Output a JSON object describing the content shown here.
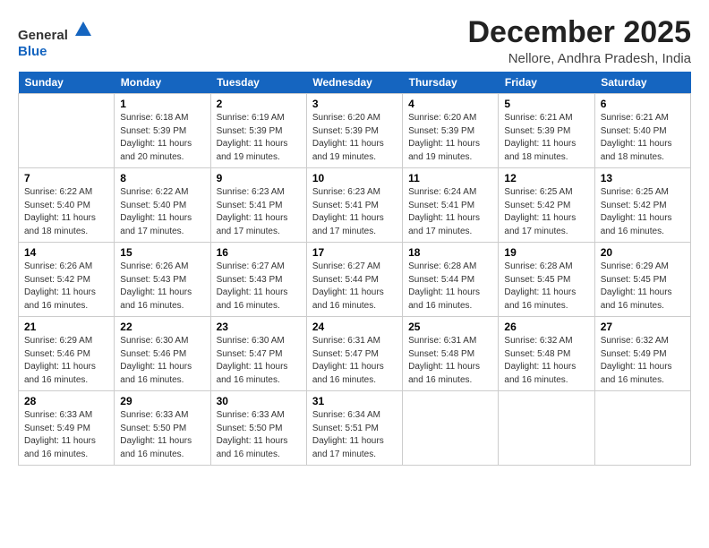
{
  "header": {
    "logo_general": "General",
    "logo_blue": "Blue",
    "title": "December 2025",
    "subtitle": "Nellore, Andhra Pradesh, India"
  },
  "calendar": {
    "headers": [
      "Sunday",
      "Monday",
      "Tuesday",
      "Wednesday",
      "Thursday",
      "Friday",
      "Saturday"
    ],
    "rows": [
      [
        {
          "day": "",
          "info": ""
        },
        {
          "day": "1",
          "info": "Sunrise: 6:18 AM\nSunset: 5:39 PM\nDaylight: 11 hours\nand 20 minutes."
        },
        {
          "day": "2",
          "info": "Sunrise: 6:19 AM\nSunset: 5:39 PM\nDaylight: 11 hours\nand 19 minutes."
        },
        {
          "day": "3",
          "info": "Sunrise: 6:20 AM\nSunset: 5:39 PM\nDaylight: 11 hours\nand 19 minutes."
        },
        {
          "day": "4",
          "info": "Sunrise: 6:20 AM\nSunset: 5:39 PM\nDaylight: 11 hours\nand 19 minutes."
        },
        {
          "day": "5",
          "info": "Sunrise: 6:21 AM\nSunset: 5:39 PM\nDaylight: 11 hours\nand 18 minutes."
        },
        {
          "day": "6",
          "info": "Sunrise: 6:21 AM\nSunset: 5:40 PM\nDaylight: 11 hours\nand 18 minutes."
        }
      ],
      [
        {
          "day": "7",
          "info": "Sunrise: 6:22 AM\nSunset: 5:40 PM\nDaylight: 11 hours\nand 18 minutes."
        },
        {
          "day": "8",
          "info": "Sunrise: 6:22 AM\nSunset: 5:40 PM\nDaylight: 11 hours\nand 17 minutes."
        },
        {
          "day": "9",
          "info": "Sunrise: 6:23 AM\nSunset: 5:41 PM\nDaylight: 11 hours\nand 17 minutes."
        },
        {
          "day": "10",
          "info": "Sunrise: 6:23 AM\nSunset: 5:41 PM\nDaylight: 11 hours\nand 17 minutes."
        },
        {
          "day": "11",
          "info": "Sunrise: 6:24 AM\nSunset: 5:41 PM\nDaylight: 11 hours\nand 17 minutes."
        },
        {
          "day": "12",
          "info": "Sunrise: 6:25 AM\nSunset: 5:42 PM\nDaylight: 11 hours\nand 17 minutes."
        },
        {
          "day": "13",
          "info": "Sunrise: 6:25 AM\nSunset: 5:42 PM\nDaylight: 11 hours\nand 16 minutes."
        }
      ],
      [
        {
          "day": "14",
          "info": "Sunrise: 6:26 AM\nSunset: 5:42 PM\nDaylight: 11 hours\nand 16 minutes."
        },
        {
          "day": "15",
          "info": "Sunrise: 6:26 AM\nSunset: 5:43 PM\nDaylight: 11 hours\nand 16 minutes."
        },
        {
          "day": "16",
          "info": "Sunrise: 6:27 AM\nSunset: 5:43 PM\nDaylight: 11 hours\nand 16 minutes."
        },
        {
          "day": "17",
          "info": "Sunrise: 6:27 AM\nSunset: 5:44 PM\nDaylight: 11 hours\nand 16 minutes."
        },
        {
          "day": "18",
          "info": "Sunrise: 6:28 AM\nSunset: 5:44 PM\nDaylight: 11 hours\nand 16 minutes."
        },
        {
          "day": "19",
          "info": "Sunrise: 6:28 AM\nSunset: 5:45 PM\nDaylight: 11 hours\nand 16 minutes."
        },
        {
          "day": "20",
          "info": "Sunrise: 6:29 AM\nSunset: 5:45 PM\nDaylight: 11 hours\nand 16 minutes."
        }
      ],
      [
        {
          "day": "21",
          "info": "Sunrise: 6:29 AM\nSunset: 5:46 PM\nDaylight: 11 hours\nand 16 minutes."
        },
        {
          "day": "22",
          "info": "Sunrise: 6:30 AM\nSunset: 5:46 PM\nDaylight: 11 hours\nand 16 minutes."
        },
        {
          "day": "23",
          "info": "Sunrise: 6:30 AM\nSunset: 5:47 PM\nDaylight: 11 hours\nand 16 minutes."
        },
        {
          "day": "24",
          "info": "Sunrise: 6:31 AM\nSunset: 5:47 PM\nDaylight: 11 hours\nand 16 minutes."
        },
        {
          "day": "25",
          "info": "Sunrise: 6:31 AM\nSunset: 5:48 PM\nDaylight: 11 hours\nand 16 minutes."
        },
        {
          "day": "26",
          "info": "Sunrise: 6:32 AM\nSunset: 5:48 PM\nDaylight: 11 hours\nand 16 minutes."
        },
        {
          "day": "27",
          "info": "Sunrise: 6:32 AM\nSunset: 5:49 PM\nDaylight: 11 hours\nand 16 minutes."
        }
      ],
      [
        {
          "day": "28",
          "info": "Sunrise: 6:33 AM\nSunset: 5:49 PM\nDaylight: 11 hours\nand 16 minutes."
        },
        {
          "day": "29",
          "info": "Sunrise: 6:33 AM\nSunset: 5:50 PM\nDaylight: 11 hours\nand 16 minutes."
        },
        {
          "day": "30",
          "info": "Sunrise: 6:33 AM\nSunset: 5:50 PM\nDaylight: 11 hours\nand 16 minutes."
        },
        {
          "day": "31",
          "info": "Sunrise: 6:34 AM\nSunset: 5:51 PM\nDaylight: 11 hours\nand 17 minutes."
        },
        {
          "day": "",
          "info": ""
        },
        {
          "day": "",
          "info": ""
        },
        {
          "day": "",
          "info": ""
        }
      ]
    ]
  }
}
